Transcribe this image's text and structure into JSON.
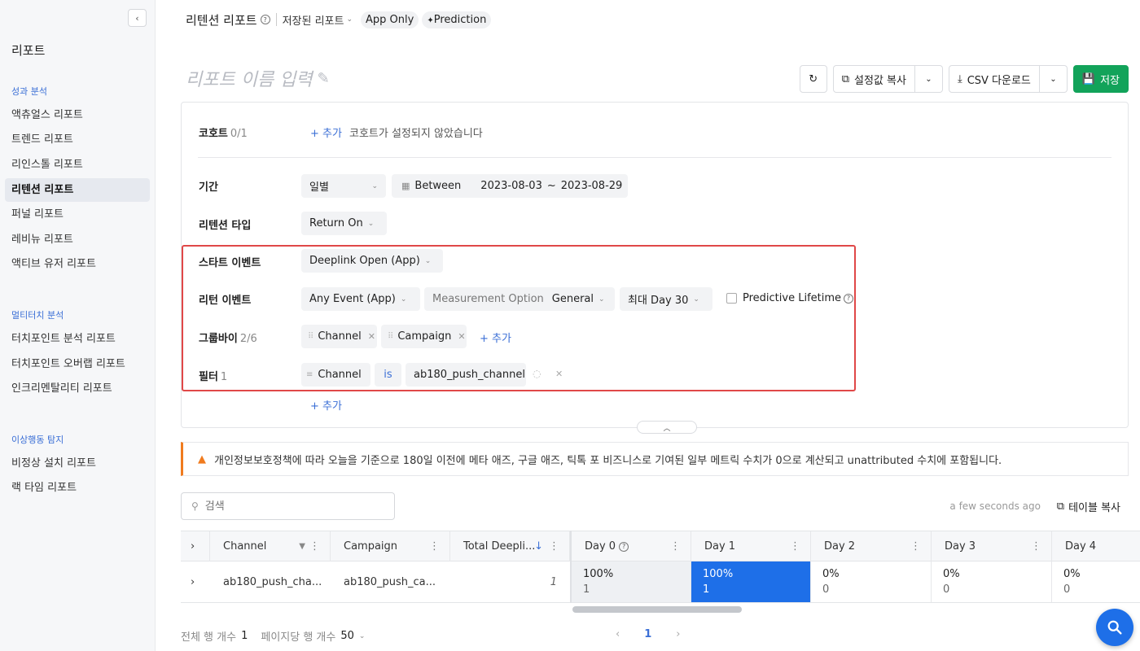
{
  "sidebar": {
    "title": "리포트",
    "sections": [
      {
        "label": "성과 분석",
        "items": [
          "액츄얼스 리포트",
          "트렌드 리포트",
          "리인스톨 리포트",
          "리텐션 리포트",
          "퍼널 리포트",
          "레비뉴 리포트",
          "액티브 유저 리포트"
        ]
      },
      {
        "label": "멀티터치 분석",
        "items": [
          "터치포인트 분석 리포트",
          "터치포인트 오버랩 리포트",
          "인크리멘탈리티 리포트"
        ]
      },
      {
        "label": "이상행동 탐지",
        "items": [
          "비정상 설치 리포트",
          "랙 타임 리포트"
        ]
      }
    ],
    "active_item": "리텐션 리포트"
  },
  "header": {
    "title": "리텐션 리포트",
    "saved_reports": "저장된 리포트",
    "tags": [
      "App Only",
      "Prediction"
    ]
  },
  "report_name_placeholder": "리포트 이름 입력",
  "toolbar": {
    "copy_settings": "설정값 복사",
    "csv_download": "CSV 다운로드",
    "save": "저장"
  },
  "config": {
    "cohort": {
      "label": "코호트",
      "count": "0/1",
      "add": "+ 추가",
      "empty": "코호트가 설정되지 않았습니다"
    },
    "period": {
      "label": "기간",
      "granularity": "일별",
      "mode": "Between",
      "start": "2023-08-03",
      "end": "2023-08-29",
      "range_sep": "~"
    },
    "retention_type": {
      "label": "리텐션 타입",
      "value": "Return On"
    },
    "start_event": {
      "label": "스타트 이벤트",
      "value": "Deeplink Open (App)"
    },
    "return_event": {
      "label": "리턴 이벤트",
      "value": "Any Event (App)",
      "measurement_label": "Measurement Option",
      "measurement_value": "General",
      "max_day": "최대 Day 30",
      "predictive": "Predictive Lifetime"
    },
    "group_by": {
      "label": "그룹바이",
      "count": "2/6",
      "chips": [
        "Channel",
        "Campaign"
      ],
      "add": "+ 추가"
    },
    "filter": {
      "label": "필터",
      "count": "1",
      "field": "Channel",
      "op": "is",
      "value": "ab180_push_channel",
      "add": "+ 추가"
    }
  },
  "notice": "개인정보보호정책에 따라 오늘을 기준으로 180일 이전에 메타 애즈, 구글 애즈, 틱톡 포 비즈니스로 기여된 일부 메트릭 수치가 0으로 계산되고 unattributed 수치에 포함됩니다.",
  "search": {
    "placeholder": "검색"
  },
  "updated": "a few seconds ago",
  "copy_table": "테이블 복사",
  "table": {
    "columns": [
      "Channel",
      "Campaign",
      "Total Deepli...",
      "Day 0",
      "Day 1",
      "Day 2",
      "Day 3",
      "Day 4"
    ],
    "rows": [
      {
        "channel": "ab180_push_cha...",
        "campaign": "ab180_push_ca...",
        "total": "1",
        "days": [
          {
            "pct": "100%",
            "n": "1"
          },
          {
            "pct": "100%",
            "n": "1"
          },
          {
            "pct": "0%",
            "n": "0"
          },
          {
            "pct": "0%",
            "n": "0"
          },
          {
            "pct": "0%",
            "n": "0"
          }
        ]
      }
    ]
  },
  "footer": {
    "total_rows_label": "전체 행 개수",
    "total_rows": "1",
    "per_page_label": "페이지당 행 개수",
    "per_page": "50",
    "current_page": "1"
  },
  "colors": {
    "accent": "#1e6fe8",
    "save": "#12a35a",
    "highlight": "#e04848",
    "warning": "#f07b1e"
  }
}
